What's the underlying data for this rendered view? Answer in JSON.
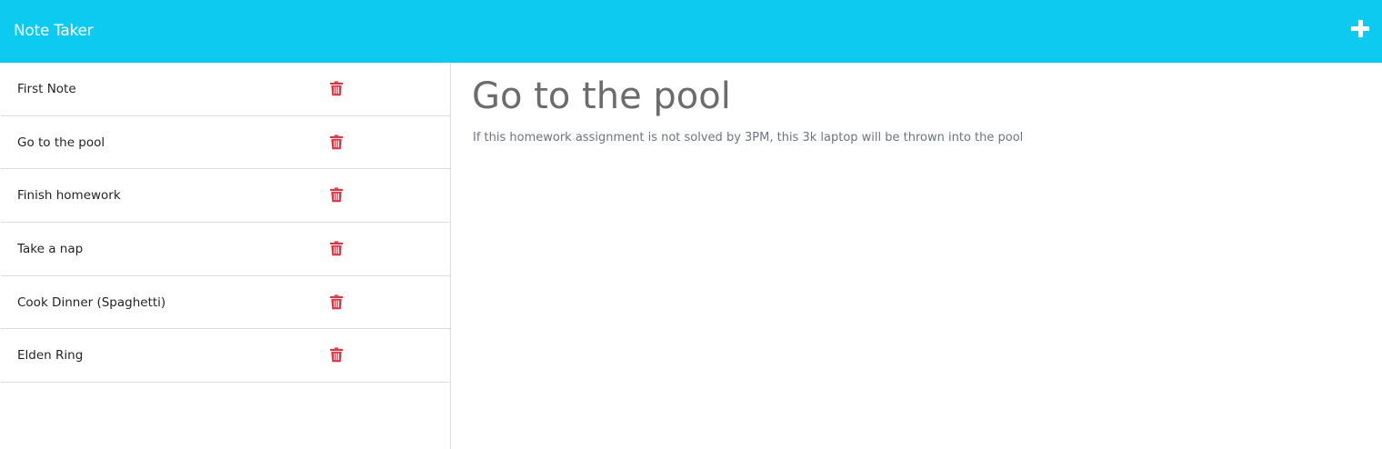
{
  "app": {
    "title": "Note Taker",
    "new_note_icon": "plus-icon",
    "accent_color": "#0dcaf0",
    "delete_color": "#dc3545"
  },
  "sidebar": {
    "notes": [
      {
        "title": "First Note",
        "icon": "trash-icon"
      },
      {
        "title": "Go to the pool",
        "icon": "trash-icon"
      },
      {
        "title": "Finish homework",
        "icon": "trash-icon"
      },
      {
        "title": "Take a nap",
        "icon": "trash-icon"
      },
      {
        "title": "Cook Dinner (Spaghetti)",
        "icon": "trash-icon"
      },
      {
        "title": "Elden Ring",
        "icon": "trash-icon"
      }
    ]
  },
  "main": {
    "note_title": "Go to the pool",
    "note_text": "If this homework assignment is not solved by 3PM, this 3k laptop will be thrown into the pool"
  }
}
